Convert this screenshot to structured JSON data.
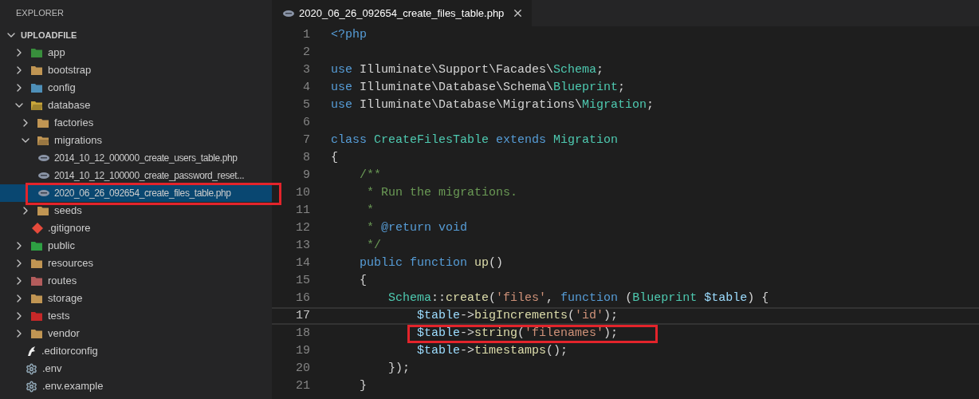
{
  "sidebar": {
    "title": "EXPLORER",
    "root": {
      "label": "UPLOADFILE",
      "expanded": true,
      "children": [
        {
          "label": "app",
          "kind": "folder",
          "color": "#388e3c",
          "expanded": false,
          "selected": false
        },
        {
          "label": "bootstrap",
          "kind": "folder",
          "color": "#c09553",
          "expanded": false,
          "selected": false
        },
        {
          "label": "config",
          "kind": "folder",
          "color": "#4e8fb8",
          "expanded": false,
          "selected": false
        },
        {
          "label": "database",
          "kind": "folder",
          "color": "#c9a63a",
          "expanded": true,
          "selected": false,
          "children": [
            {
              "label": "factories",
              "kind": "folder",
              "color": "#c09553",
              "expanded": false,
              "selected": false
            },
            {
              "label": "migrations",
              "kind": "folder",
              "color": "#c09553",
              "expanded": true,
              "selected": false,
              "children": [
                {
                  "label": "2014_10_12_000000_create_users_table.php",
                  "kind": "php-file",
                  "selected": false,
                  "annotated": false
                },
                {
                  "label": "2014_10_12_100000_create_password_reset...",
                  "kind": "php-file",
                  "selected": false,
                  "annotated": false
                },
                {
                  "label": "2020_06_26_092654_create_files_table.php",
                  "kind": "php-file",
                  "selected": true,
                  "annotated": true
                }
              ]
            },
            {
              "label": "seeds",
              "kind": "folder",
              "color": "#c09553",
              "expanded": false,
              "selected": false
            },
            {
              "label": ".gitignore",
              "kind": "git-file",
              "selected": false
            }
          ]
        },
        {
          "label": "public",
          "kind": "folder",
          "color": "#2ea043",
          "expanded": false,
          "selected": false
        },
        {
          "label": "resources",
          "kind": "folder",
          "color": "#c09553",
          "expanded": false,
          "selected": false
        },
        {
          "label": "routes",
          "kind": "folder",
          "color": "#b35c5c",
          "expanded": false,
          "selected": false
        },
        {
          "label": "storage",
          "kind": "folder",
          "color": "#c09553",
          "expanded": false,
          "selected": false
        },
        {
          "label": "tests",
          "kind": "folder",
          "color": "#c62828",
          "expanded": false,
          "selected": false
        },
        {
          "label": "vendor",
          "kind": "folder",
          "color": "#c09553",
          "expanded": false,
          "selected": false
        },
        {
          "label": ".editorconfig",
          "kind": "editorconfig-file",
          "selected": false
        },
        {
          "label": ".env",
          "kind": "env-file",
          "selected": false
        },
        {
          "label": ".env.example",
          "kind": "env-file",
          "selected": false
        }
      ]
    }
  },
  "tabs": [
    {
      "label": "2020_06_26_092654_create_files_table.php",
      "selected": true
    }
  ],
  "editor": {
    "lines": [
      {
        "number": "1",
        "current": false,
        "annotated": false,
        "tokens": [
          {
            "kind": "keyword",
            "text": "<?php"
          }
        ]
      },
      {
        "number": "2",
        "current": false,
        "annotated": false
      },
      {
        "number": "3",
        "current": false,
        "annotated": false,
        "tokens": [
          {
            "kind": "keyword",
            "text": "use"
          },
          {
            "kind": "plain",
            "text": " Illuminate\\Support\\Facades\\"
          },
          {
            "kind": "class",
            "text": "Schema"
          },
          {
            "kind": "plain",
            "text": ";"
          }
        ]
      },
      {
        "number": "4",
        "current": false,
        "annotated": false,
        "tokens": [
          {
            "kind": "keyword",
            "text": "use"
          },
          {
            "kind": "plain",
            "text": " Illuminate\\Database\\Schema\\"
          },
          {
            "kind": "class",
            "text": "Blueprint"
          },
          {
            "kind": "plain",
            "text": ";"
          }
        ]
      },
      {
        "number": "5",
        "current": false,
        "annotated": false,
        "tokens": [
          {
            "kind": "keyword",
            "text": "use"
          },
          {
            "kind": "plain",
            "text": " Illuminate\\Database\\Migrations\\"
          },
          {
            "kind": "class",
            "text": "Migration"
          },
          {
            "kind": "plain",
            "text": ";"
          }
        ]
      },
      {
        "number": "6",
        "current": false,
        "annotated": false
      },
      {
        "number": "7",
        "current": false,
        "annotated": false,
        "tokens": [
          {
            "kind": "keyword",
            "text": "class"
          },
          {
            "kind": "class",
            "text": " CreateFilesTable"
          },
          {
            "kind": "keyword",
            "text": " extends"
          },
          {
            "kind": "class",
            "text": " Migration"
          }
        ]
      },
      {
        "number": "8",
        "current": false,
        "annotated": false,
        "tokens": [
          {
            "kind": "plain",
            "text": "{"
          }
        ]
      },
      {
        "number": "9",
        "current": false,
        "annotated": false,
        "tokens": [
          {
            "kind": "comment",
            "text": "    /**"
          }
        ]
      },
      {
        "number": "10",
        "current": false,
        "annotated": false,
        "tokens": [
          {
            "kind": "comment",
            "text": "     * Run the migrations."
          }
        ]
      },
      {
        "number": "11",
        "current": false,
        "annotated": false,
        "tokens": [
          {
            "kind": "comment",
            "text": "     *"
          }
        ]
      },
      {
        "number": "12",
        "current": false,
        "annotated": false,
        "tokens": [
          {
            "kind": "comment",
            "text": "     * "
          },
          {
            "kind": "keyword",
            "text": "@return void"
          }
        ]
      },
      {
        "number": "13",
        "current": false,
        "annotated": false,
        "tokens": [
          {
            "kind": "comment",
            "text": "     */"
          }
        ]
      },
      {
        "number": "14",
        "current": false,
        "annotated": false,
        "tokens": [
          {
            "kind": "keyword",
            "text": "    public function"
          },
          {
            "kind": "function",
            "text": " up"
          },
          {
            "kind": "plain",
            "text": "()"
          }
        ]
      },
      {
        "number": "15",
        "current": false,
        "annotated": false,
        "tokens": [
          {
            "kind": "plain",
            "text": "    {"
          }
        ]
      },
      {
        "number": "16",
        "current": false,
        "annotated": false,
        "tokens": [
          {
            "kind": "class",
            "text": "        Schema"
          },
          {
            "kind": "plain",
            "text": "::"
          },
          {
            "kind": "function",
            "text": "create"
          },
          {
            "kind": "plain",
            "text": "("
          },
          {
            "kind": "string",
            "text": "'files'"
          },
          {
            "kind": "plain",
            "text": ", "
          },
          {
            "kind": "keyword",
            "text": "function"
          },
          {
            "kind": "plain",
            "text": " ("
          },
          {
            "kind": "class",
            "text": "Blueprint"
          },
          {
            "kind": "variable",
            "text": " $table"
          },
          {
            "kind": "plain",
            "text": ") {"
          }
        ]
      },
      {
        "number": "17",
        "current": true,
        "annotated": false,
        "tokens": [
          {
            "kind": "variable",
            "text": "            $table"
          },
          {
            "kind": "plain",
            "text": "->"
          },
          {
            "kind": "function",
            "text": "bigIncrements"
          },
          {
            "kind": "plain",
            "text": "("
          },
          {
            "kind": "string",
            "text": "'id'"
          },
          {
            "kind": "plain",
            "text": ");"
          }
        ]
      },
      {
        "number": "18",
        "current": false,
        "annotated": true,
        "tokens": [
          {
            "kind": "variable",
            "text": "            $table"
          },
          {
            "kind": "plain",
            "text": "->"
          },
          {
            "kind": "function",
            "text": "string"
          },
          {
            "kind": "plain",
            "text": "("
          },
          {
            "kind": "string",
            "text": "'filenames'"
          },
          {
            "kind": "plain",
            "text": ");"
          }
        ]
      },
      {
        "number": "19",
        "current": false,
        "annotated": false,
        "tokens": [
          {
            "kind": "variable",
            "text": "            $table"
          },
          {
            "kind": "plain",
            "text": "->"
          },
          {
            "kind": "function",
            "text": "timestamps"
          },
          {
            "kind": "plain",
            "text": "();"
          }
        ]
      },
      {
        "number": "20",
        "current": false,
        "annotated": false,
        "tokens": [
          {
            "kind": "plain",
            "text": "        });"
          }
        ]
      },
      {
        "number": "21",
        "current": false,
        "annotated": false,
        "tokens": [
          {
            "kind": "plain",
            "text": "    }"
          }
        ]
      }
    ]
  }
}
